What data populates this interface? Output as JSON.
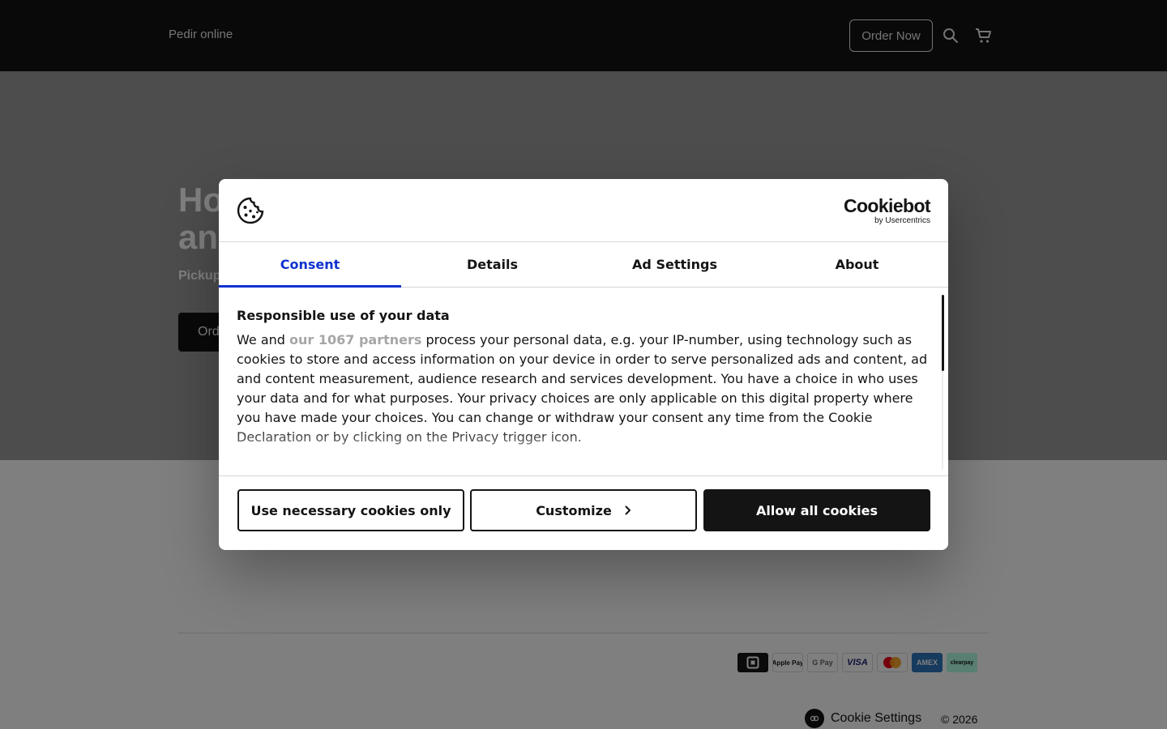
{
  "header": {
    "brand": "Pedir online",
    "order_now": "Order Now",
    "icons": [
      "search-icon",
      "cart-icon"
    ]
  },
  "hero": {
    "title_visible": "Ho\nan",
    "subtitle_visible": "Pickup",
    "button_visible": "Ord"
  },
  "footer": {
    "payment_methods": [
      {
        "name": "square",
        "label": ""
      },
      {
        "name": "apple-pay",
        "label": "Apple Pay"
      },
      {
        "name": "google-pay",
        "label": "G Pay"
      },
      {
        "name": "visa",
        "label": "VISA"
      },
      {
        "name": "mastercard",
        "label": ""
      },
      {
        "name": "amex",
        "label": "AMEX"
      },
      {
        "name": "clearpay",
        "label": "clearpay"
      }
    ],
    "cookie_settings": "Cookie Settings",
    "copyright": "© 2026"
  },
  "dialog": {
    "brand_name": "Cookiebot",
    "brand_by": "by Usercentrics",
    "tabs": [
      {
        "label": "Consent",
        "active": true
      },
      {
        "label": "Details",
        "active": false
      },
      {
        "label": "Ad Settings",
        "active": false
      },
      {
        "label": "About",
        "active": false
      }
    ],
    "heading": "Responsible use of your data",
    "text_before_link": "We and ",
    "partners_link": "our 1067 partners",
    "text_after_link": " process your personal data, e.g. your IP-number, using technology such as cookies to store and access information on your device in order to serve personalized ads and content, ad and content measurement, audience research and services development. You have a choice in who uses your data and for what purposes. Your privacy choices are only applicable on this digital property where you have made your choices. You can change or withdraw your consent any time from the Cookie Declaration or by clicking on the Privacy trigger icon.",
    "buttons": {
      "necessary": "Use necessary cookies only",
      "customize": "Customize",
      "allow_all": "Allow all cookies"
    },
    "colors": {
      "accent": "#1032cf",
      "text": "#141414"
    }
  }
}
